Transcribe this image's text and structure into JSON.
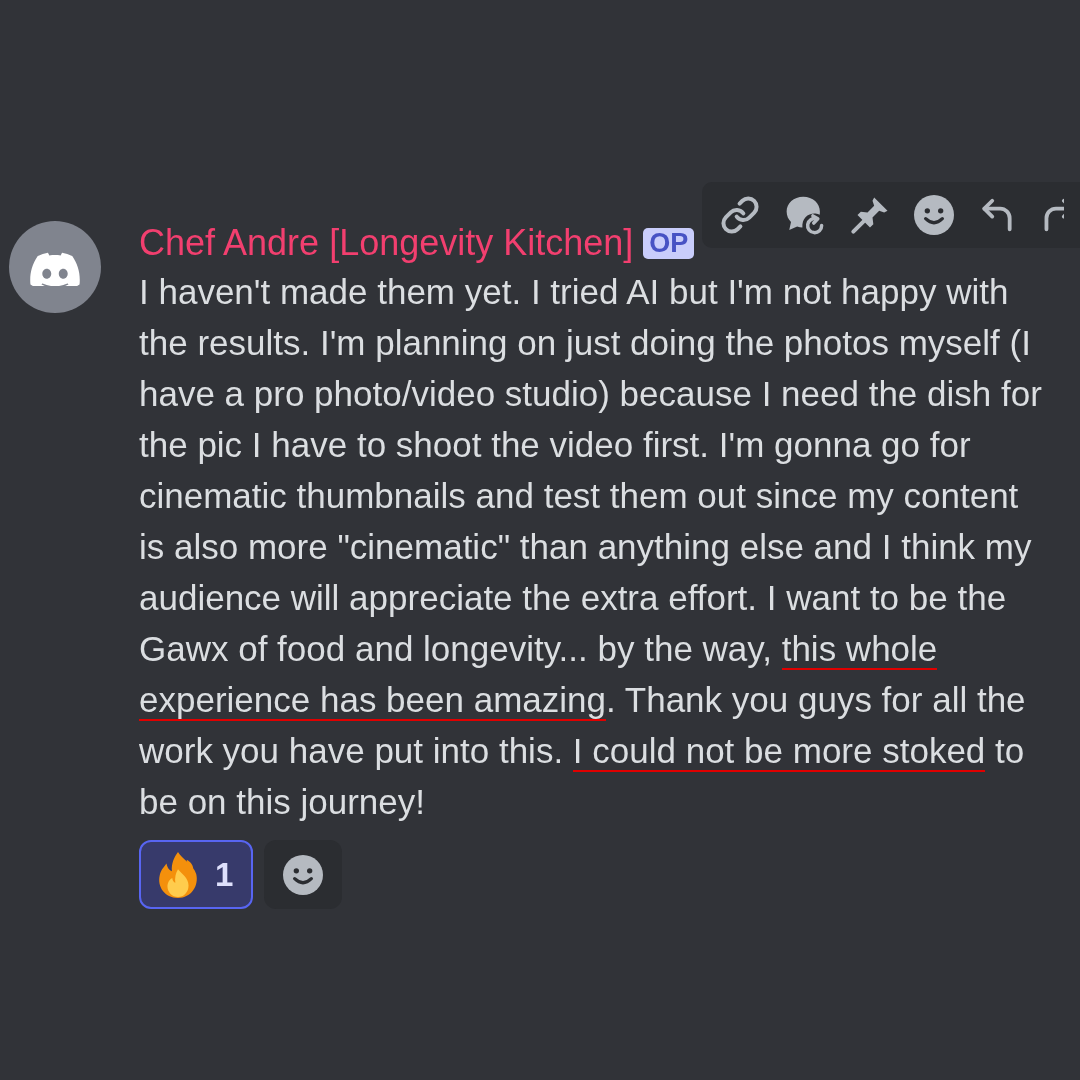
{
  "message": {
    "author": "Chef Andre [Longevity Kitchen]",
    "badge": "OP",
    "content": [
      {
        "text": "I haven't made them yet. I tried AI but I'm not happy with the results. I'm planning on just doing the photos myself (I have a pro photo/video studio) because I need the dish for the pic I have to shoot the video first. I'm gonna go for cinematic thumbnails and test them out since my content is also more \"cinematic\" than anything else and I think my audience will appreciate the extra effort. I want to be the Gawx of food and longevity... by the way, ",
        "underlined": false
      },
      {
        "text": "this whole experience has been amazing",
        "underlined": true
      },
      {
        "text": ". Thank you guys for all the work you have put into this. ",
        "underlined": false
      },
      {
        "text": "I could not be more stoked",
        "underlined": true
      },
      {
        "text": " to be on this journey!",
        "underlined": false
      }
    ],
    "reactions": [
      {
        "count": "1",
        "selected": true
      }
    ]
  }
}
